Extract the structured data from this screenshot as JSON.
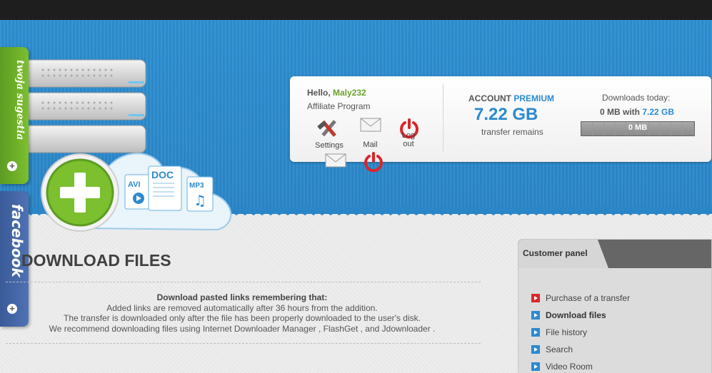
{
  "side_tabs": {
    "suggestion": {
      "label": "twoja sugestia",
      "plus": "+"
    },
    "facebook": {
      "label": "facebook",
      "plus": "+"
    }
  },
  "header_art": {
    "cloud_labels": [
      "AVI",
      "DOC",
      "MP3"
    ]
  },
  "account_panel": {
    "greeting": "Hello,",
    "username": "Maly232",
    "affiliate": "Affiliate Program",
    "settings_label": "Settings",
    "mail_label": "Mail",
    "logout_label": "Log out",
    "account_prefix": "ACCOUNT",
    "account_type": "PREMIUM",
    "transfer_amount": "7.22 GB",
    "transfer_sub": "transfer remains",
    "downloads_label": "Downloads today:",
    "downloads_used": "0 MB with",
    "downloads_limit": "7.22 GB",
    "progress_text": "0 MB",
    "progress_fraction": 0
  },
  "main": {
    "title": "DOWNLOAD FILES",
    "notice_head": "Download pasted links remembering that:",
    "notice_lines": [
      "Added links are removed automatically after 36 hours from the addition.",
      "The transfer is downloaded only after the file has been properly downloaded to the user's disk.",
      "We recommend downloading files using Internet Downloader Manager , FlashGet , and Jdownloader ."
    ]
  },
  "customer_panel": {
    "title": "Customer panel",
    "items": [
      {
        "label": "Purchase of a transfer",
        "color": "#d8262b"
      },
      {
        "label": "Download files",
        "color": "#2b8ad0"
      },
      {
        "label": "File history",
        "color": "#2b8ad0"
      },
      {
        "label": "Search",
        "color": "#2b8ad0"
      },
      {
        "label": "Video Room",
        "color": "#2b8ad0"
      }
    ]
  },
  "colors": {
    "header_blue": "#2b86c8",
    "accent_green": "#6aa22e",
    "accent_blue": "#2b8ad0",
    "logout_red": "#d8262b"
  }
}
